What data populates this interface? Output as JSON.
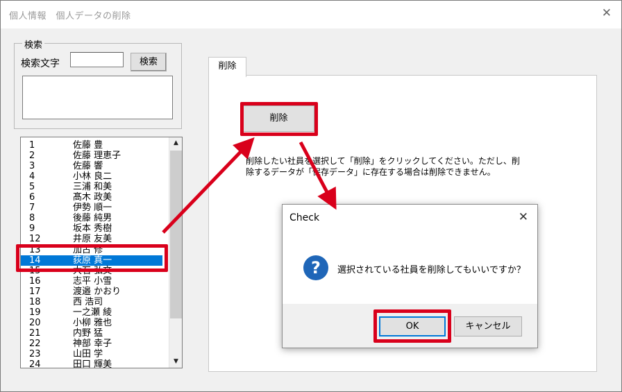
{
  "window": {
    "title": "個人情報　個人データの削除",
    "close_glyph": "✕"
  },
  "search": {
    "group_label": "検索",
    "label": "検索文字",
    "input_value": "",
    "button_label": "検索"
  },
  "employees": [
    {
      "num": "1",
      "name": "佐藤 豊"
    },
    {
      "num": "2",
      "name": "佐藤 理恵子"
    },
    {
      "num": "3",
      "name": "佐藤 響"
    },
    {
      "num": "4",
      "name": "小林 良二"
    },
    {
      "num": "5",
      "name": "三浦 和美"
    },
    {
      "num": "6",
      "name": "髙木 政美"
    },
    {
      "num": "7",
      "name": "伊勢 順一"
    },
    {
      "num": "8",
      "name": "後藤 純男"
    },
    {
      "num": "9",
      "name": "坂本 秀樹"
    },
    {
      "num": "12",
      "name": "井原 友美"
    },
    {
      "num": "13",
      "name": "加古 修"
    },
    {
      "num": "14",
      "name": "荻原 真一"
    },
    {
      "num": "15",
      "name": "大石 弘文"
    },
    {
      "num": "16",
      "name": "志平 小雪"
    },
    {
      "num": "17",
      "name": "渡邉 かおり"
    },
    {
      "num": "18",
      "name": "西 浩司"
    },
    {
      "num": "19",
      "name": "一之瀬 綾"
    },
    {
      "num": "20",
      "name": "小柳 雅也"
    },
    {
      "num": "21",
      "name": "内野 猛"
    },
    {
      "num": "22",
      "name": "神部 幸子"
    },
    {
      "num": "23",
      "name": "山田 学"
    },
    {
      "num": "24",
      "name": "田口 輝美"
    }
  ],
  "selected_index": 11,
  "scrollbar": {
    "up_glyph": "▲",
    "down_glyph": "▼"
  },
  "tab": {
    "label": "削除",
    "delete_button": "削除",
    "description_line1": "削除したい社員を選択して「削除」をクリックしてください。ただし、削",
    "description_line2": "除するデータが「保存データ」に存在する場合は削除できません。"
  },
  "dialog": {
    "title": "Check",
    "close_glyph": "✕",
    "icon": "question-icon",
    "icon_glyph": "?",
    "message": "選択されている社員を削除してもいいですか？",
    "ok_label": "OK",
    "cancel_label": "キャンセル"
  },
  "colors": {
    "highlight": "#d9001b",
    "selection": "#0078d7",
    "icon_blue": "#1f66b8"
  }
}
